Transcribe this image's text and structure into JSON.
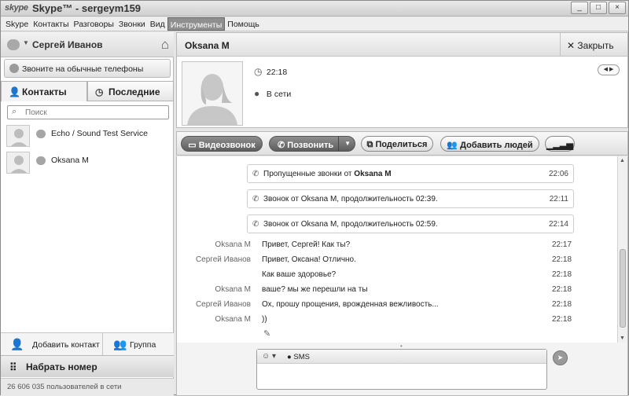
{
  "window": {
    "logo": "skype",
    "title": "Skype™ - sergeym159",
    "controls": [
      "_",
      "□",
      "×"
    ]
  },
  "menu": [
    "Skype",
    "Контакты",
    "Разговоры",
    "Звонки",
    "Вид",
    "Инструменты",
    "Помощь"
  ],
  "menu_active": "Инструменты",
  "profile": {
    "name": "Сергей Иванов",
    "status_icon": "status-icon",
    "home_icon": "home-icon"
  },
  "call_phones": "Звоните на обычные телефоны",
  "tabs": {
    "contacts": "Контакты",
    "recent": "Последние"
  },
  "search_placeholder": "Поиск",
  "contacts": [
    {
      "name": "Echo / Sound Test Service"
    },
    {
      "name": "Oksana M"
    }
  ],
  "left_buttons": {
    "add_contact": "Добавить контакт",
    "group": "Группа",
    "dial": "Набрать номер"
  },
  "users_online": "26 606 035 пользователей в сети",
  "conversation": {
    "contact_name": "Oksana M",
    "close": "Закрыть",
    "time": "22:18",
    "status": "В сети"
  },
  "toolbar": {
    "video": "Видеозвонок",
    "call": "Позвонить",
    "share": "Поделиться",
    "add_people": "Добавить людей"
  },
  "system_messages": [
    {
      "prefix": "Пропущенные звонки от ",
      "bold": "Oksana M",
      "time": "22:06"
    },
    {
      "text": "Звонок от Oksana M, продолжительность 02:39.",
      "time": "22:11"
    },
    {
      "text": "Звонок от Oksana M, продолжительность 02:59.",
      "time": "22:14"
    }
  ],
  "messages": [
    {
      "sender": "Oksana M",
      "text": "Привет, Сергей! Как ты?",
      "time": "22:17"
    },
    {
      "sender": "Сергей Иванов",
      "text": "Привет, Оксана! Отлично.",
      "time": "22:18"
    },
    {
      "sender": "",
      "text": "Как ваше здоровье?",
      "time": "22:18"
    },
    {
      "sender": "Oksana M",
      "text": "ваше? мы же перешли на ты",
      "time": "22:18"
    },
    {
      "sender": "Сергей Иванов",
      "text": "Ох, прошу прощения, врожденная вежливость...",
      "time": "22:18"
    },
    {
      "sender": "Oksana M",
      "text": "))",
      "time": "22:18"
    }
  ],
  "compose": {
    "sms": "SMS"
  }
}
